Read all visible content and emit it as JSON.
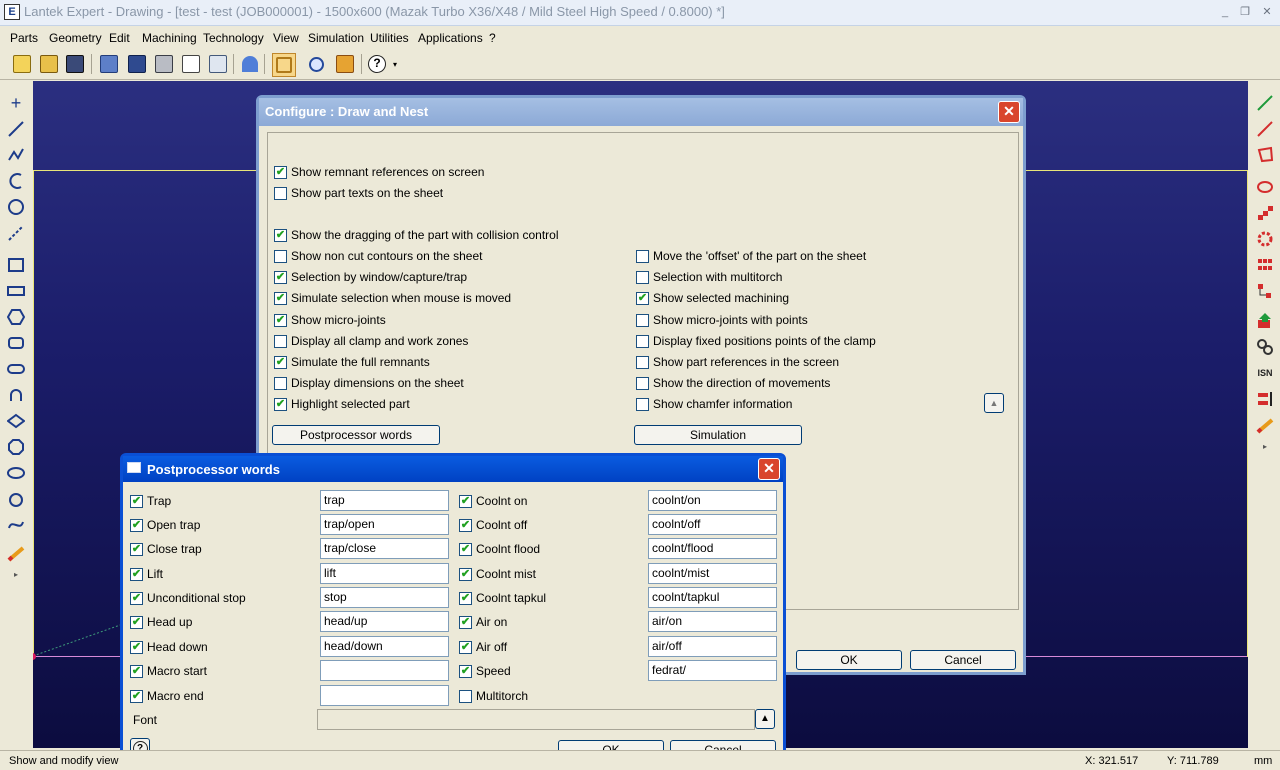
{
  "window": {
    "title": "Lantek Expert  - Drawing - [test - test (JOB000001) - 1500x600  (Mazak Turbo X36/X48 / Mild Steel High Speed / 0.8000) *]",
    "minimize": "_",
    "restore": "❐",
    "close": "✕"
  },
  "menu": [
    "Parts",
    "Geometry",
    "Edit",
    "Machining",
    "Technology",
    "View",
    "Simulation",
    "Utilities",
    "Applications",
    "?"
  ],
  "toolbar_icons": [
    "new-icon",
    "open-icon",
    "save-icon",
    "import-icon",
    "export-icon",
    "print-icon",
    "print-preview-icon",
    "zoom-window-icon",
    "zoom-all-icon",
    "undo-icon",
    "select-icon",
    "zoom-icon",
    "nest-icon",
    "help-icon"
  ],
  "left_tools": [
    "point-tool",
    "line-tool",
    "polyline-tool",
    "arc-tool",
    "circle-tool",
    "construction-line-tool",
    "rectangle-tool",
    "slot-rect-tool",
    "hexagon-tool",
    "rounded-rect-tool",
    "rounded-rect2-tool",
    "keyhole-tool",
    "diamond-tool",
    "octagon-tool",
    "ellipse-tool",
    "hand-tool",
    "curve-tool",
    "pencil-tool"
  ],
  "right_tools": [
    "green-line-tool",
    "red-line-tool",
    "polygon-tool",
    "ellipse-red-tool",
    "stairs-tool",
    "gear-tool",
    "grid-tool",
    "tree-tool",
    "download-tool",
    "chain-tool",
    "isn-tool",
    "flag-tool",
    "pencil-tool"
  ],
  "status": {
    "message": "Show and modify view",
    "x": "X: 321.517",
    "y": "Y: 711.789",
    "unit": "mm"
  },
  "config_dialog": {
    "title": "Configure : Draw and Nest",
    "close": "✕",
    "options_left": [
      {
        "label": "Show remnant references on screen",
        "checked": true
      },
      {
        "label": "Show part texts on the sheet",
        "checked": false
      },
      {
        "label": "Show the dragging of the part with collision control",
        "checked": true
      },
      {
        "label": "Show non cut contours on the sheet",
        "checked": false
      },
      {
        "label": "Selection by window/capture/trap",
        "checked": true
      },
      {
        "label": "Simulate selection when mouse is moved",
        "checked": true
      },
      {
        "label": "Show micro-joints",
        "checked": true
      },
      {
        "label": "Display all clamp and work zones",
        "checked": false
      },
      {
        "label": "Simulate the full remnants",
        "checked": true
      },
      {
        "label": "Display dimensions on the sheet",
        "checked": false
      },
      {
        "label": "Highlight selected part",
        "checked": true
      }
    ],
    "options_right": [
      {
        "label": "Move the 'offset' of the part on the sheet",
        "checked": false
      },
      {
        "label": "Selection with multitorch",
        "checked": false
      },
      {
        "label": "Show selected machining",
        "checked": true
      },
      {
        "label": "Show micro-joints with points",
        "checked": false
      },
      {
        "label": "Display fixed positions points of the clamp",
        "checked": false
      },
      {
        "label": "Show part references in the screen",
        "checked": false
      },
      {
        "label": "Show the direction of movements",
        "checked": false
      },
      {
        "label": "Show chamfer information",
        "checked": false
      }
    ],
    "postprocessor_button": "Postprocessor words",
    "simulation_button": "Simulation",
    "scroll_up": "▲",
    "ok": "OK",
    "cancel": "Cancel"
  },
  "pp_dialog": {
    "title": "Postprocessor words",
    "close": "✕",
    "left": [
      {
        "label": "Trap",
        "checked": true,
        "value": "trap"
      },
      {
        "label": "Open trap",
        "checked": true,
        "value": "trap/open"
      },
      {
        "label": "Close trap",
        "checked": true,
        "value": "trap/close"
      },
      {
        "label": "Lift",
        "checked": true,
        "value": "lift"
      },
      {
        "label": "Unconditional stop",
        "checked": true,
        "value": "stop"
      },
      {
        "label": "Head up",
        "checked": true,
        "value": "head/up"
      },
      {
        "label": "Head down",
        "checked": true,
        "value": "head/down"
      },
      {
        "label": "Macro start",
        "checked": true,
        "value": ""
      },
      {
        "label": "Macro end",
        "checked": true,
        "value": ""
      }
    ],
    "right": [
      {
        "label": "Coolnt on",
        "checked": true,
        "value": "coolnt/on"
      },
      {
        "label": "Coolnt off",
        "checked": true,
        "value": "coolnt/off"
      },
      {
        "label": "Coolnt flood",
        "checked": true,
        "value": "coolnt/flood"
      },
      {
        "label": "Coolnt mist",
        "checked": true,
        "value": "coolnt/mist"
      },
      {
        "label": "Coolnt tapkul",
        "checked": true,
        "value": "coolnt/tapkul"
      },
      {
        "label": "Air on",
        "checked": true,
        "value": "air/on"
      },
      {
        "label": "Air off",
        "checked": true,
        "value": "air/off"
      },
      {
        "label": "Speed",
        "checked": true,
        "value": "fedrat/"
      },
      {
        "label": "Multitorch",
        "checked": false,
        "value": null
      }
    ],
    "font_label": "Font",
    "font_value": "",
    "font_button": "▲",
    "help": "?",
    "ok": "OK",
    "cancel": "Cancel"
  },
  "check_mark": "✔"
}
